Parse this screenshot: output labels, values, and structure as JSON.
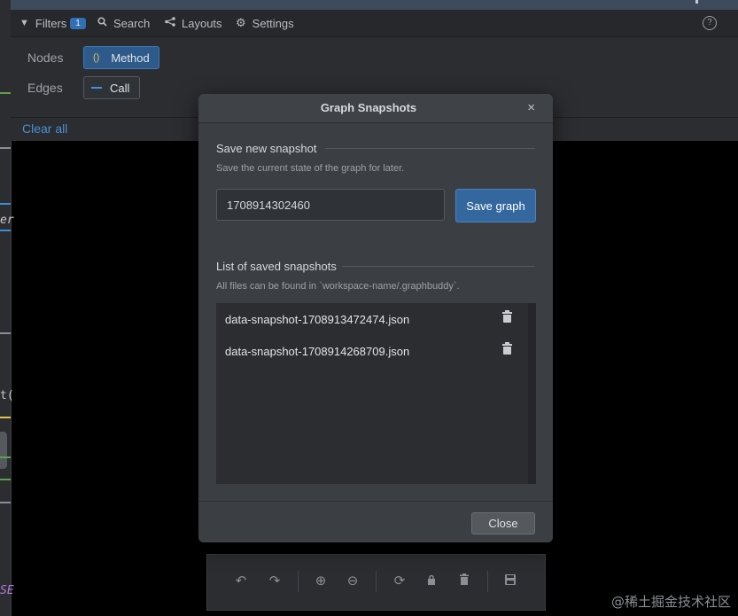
{
  "tabs": [
    {
      "label": "Filters",
      "icon": "filter-icon",
      "badge": "1"
    },
    {
      "label": "Search",
      "icon": "search-icon"
    },
    {
      "label": "Layouts",
      "icon": "layouts-icon"
    },
    {
      "label": "Settings",
      "icon": "gear-icon"
    }
  ],
  "help_icon": "help-icon",
  "filters": {
    "nodes_label": "Nodes",
    "edges_label": "Edges",
    "node_chip": {
      "icon": "()",
      "label": "Method"
    },
    "edge_chip": {
      "label": "Call"
    },
    "clear_all": "Clear all"
  },
  "gutter": {
    "snippet_1": "er",
    "snippet_2": "t(",
    "snippet_3": "SE"
  },
  "modal": {
    "title": "Graph Snapshots",
    "close_icon": "×",
    "save_section": {
      "title": "Save new snapshot",
      "subtitle": "Save the current state of the graph for later.",
      "input_value": "1708914302460",
      "save_button": "Save graph"
    },
    "list_section": {
      "title": "List of saved snapshots",
      "subtitle": "All files can be found in `workspace-name/.graphbuddy`.",
      "items": [
        {
          "name": "data-snapshot-1708913472474.json"
        },
        {
          "name": "data-snapshot-1708914268709.json"
        }
      ]
    },
    "close_button": "Close"
  },
  "toolbar": [
    "undo-icon",
    "redo-icon",
    "zoom-in-icon",
    "zoom-out-icon",
    "refresh-icon",
    "lock-icon",
    "trash-icon",
    "save-icon"
  ],
  "watermark": "@稀土掘金技术社区",
  "colors": {
    "accent": "#34679d",
    "link": "#4a8fd6",
    "modal_bg": "#3b3e42",
    "panel_bg": "#2b2d30"
  }
}
